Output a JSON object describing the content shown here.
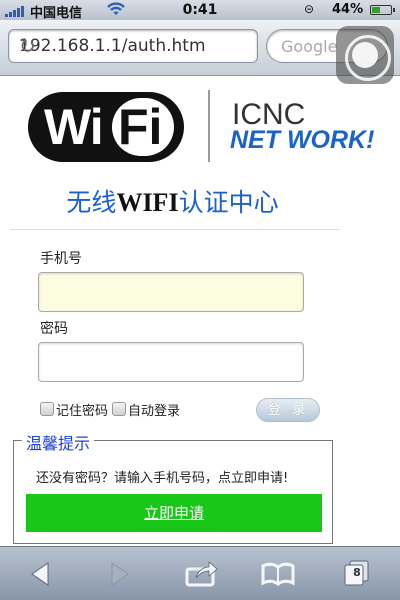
{
  "status_bar": {
    "carrier": "中国电信",
    "time": "0:41",
    "battery": "44%",
    "battery_level": 0.44
  },
  "browser": {
    "url": "192.168.1.1/auth.htm",
    "search_placeholder": "Google"
  },
  "logo": {
    "wi": "Wi",
    "fi": "Fi",
    "brand_line1": "ICNC",
    "brand_line2": "NET WORK!"
  },
  "page": {
    "title_prefix": "无线",
    "title_bold": "WIFI",
    "title_suffix": "认证中心"
  },
  "form": {
    "phone_label": "手机号",
    "phone_value": "",
    "password_label": "密码",
    "password_value": "",
    "remember_label": "记住密码",
    "auto_login_label": "自动登录",
    "login_label": "登 录"
  },
  "tips": {
    "legend": "温馨提示",
    "text": "还没有密码？请输入手机号码，点立即申请!",
    "apply_label": "立即申请"
  },
  "toolbar": {
    "tabs_count": "8"
  },
  "colors": {
    "title_blue": "#1b5fd0",
    "brand_blue": "#1b63c8",
    "apply_green": "#19c719",
    "legend_blue": "#1b3ee0"
  }
}
